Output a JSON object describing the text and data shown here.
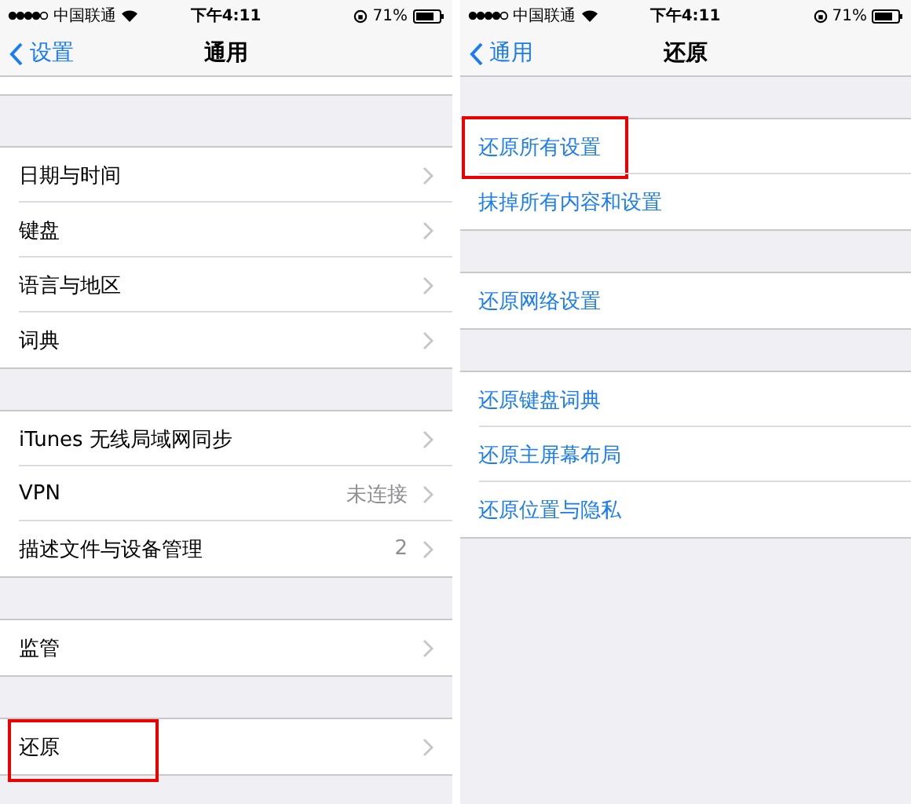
{
  "screens": [
    {
      "status_bar": {
        "carrier": "中国联通",
        "time": "下午4:11",
        "battery": "71%"
      },
      "nav": {
        "back": "设置",
        "title": "通用"
      },
      "cut_row": true,
      "groups": [
        {
          "rows": [
            {
              "kind": "link",
              "label": "日期与时间",
              "highlighted": false
            },
            {
              "kind": "link",
              "label": "键盘",
              "highlighted": false
            },
            {
              "kind": "link",
              "label": "语言与地区",
              "highlighted": false
            },
            {
              "kind": "link",
              "label": "词典",
              "highlighted": false
            }
          ]
        },
        {
          "rows": [
            {
              "kind": "link",
              "label": "iTunes 无线局域网同步",
              "highlighted": false
            },
            {
              "kind": "link",
              "label": "VPN",
              "value": "未连接",
              "highlighted": false
            },
            {
              "kind": "link",
              "label": "描述文件与设备管理",
              "value": "2",
              "highlighted": false
            }
          ]
        },
        {
          "rows": [
            {
              "kind": "link",
              "label": "监管",
              "highlighted": false
            }
          ]
        },
        {
          "rows": [
            {
              "kind": "link",
              "label": "还原",
              "highlighted": true
            }
          ]
        }
      ]
    },
    {
      "status_bar": {
        "carrier": "中国联通",
        "time": "下午4:11",
        "battery": "71%"
      },
      "nav": {
        "back": "通用",
        "title": "还原"
      },
      "groups": [
        {
          "rows": [
            {
              "kind": "action",
              "label": "还原所有设置",
              "highlighted": true
            },
            {
              "kind": "action",
              "label": "抹掉所有内容和设置",
              "highlighted": false
            }
          ]
        },
        {
          "rows": [
            {
              "kind": "action",
              "label": "还原网络设置",
              "highlighted": false
            }
          ]
        },
        {
          "rows": [
            {
              "kind": "action",
              "label": "还原键盘词典",
              "highlighted": false
            },
            {
              "kind": "action",
              "label": "还原主屏幕布局",
              "highlighted": false
            },
            {
              "kind": "action",
              "label": "还原位置与隐私",
              "highlighted": false
            }
          ]
        }
      ]
    }
  ]
}
